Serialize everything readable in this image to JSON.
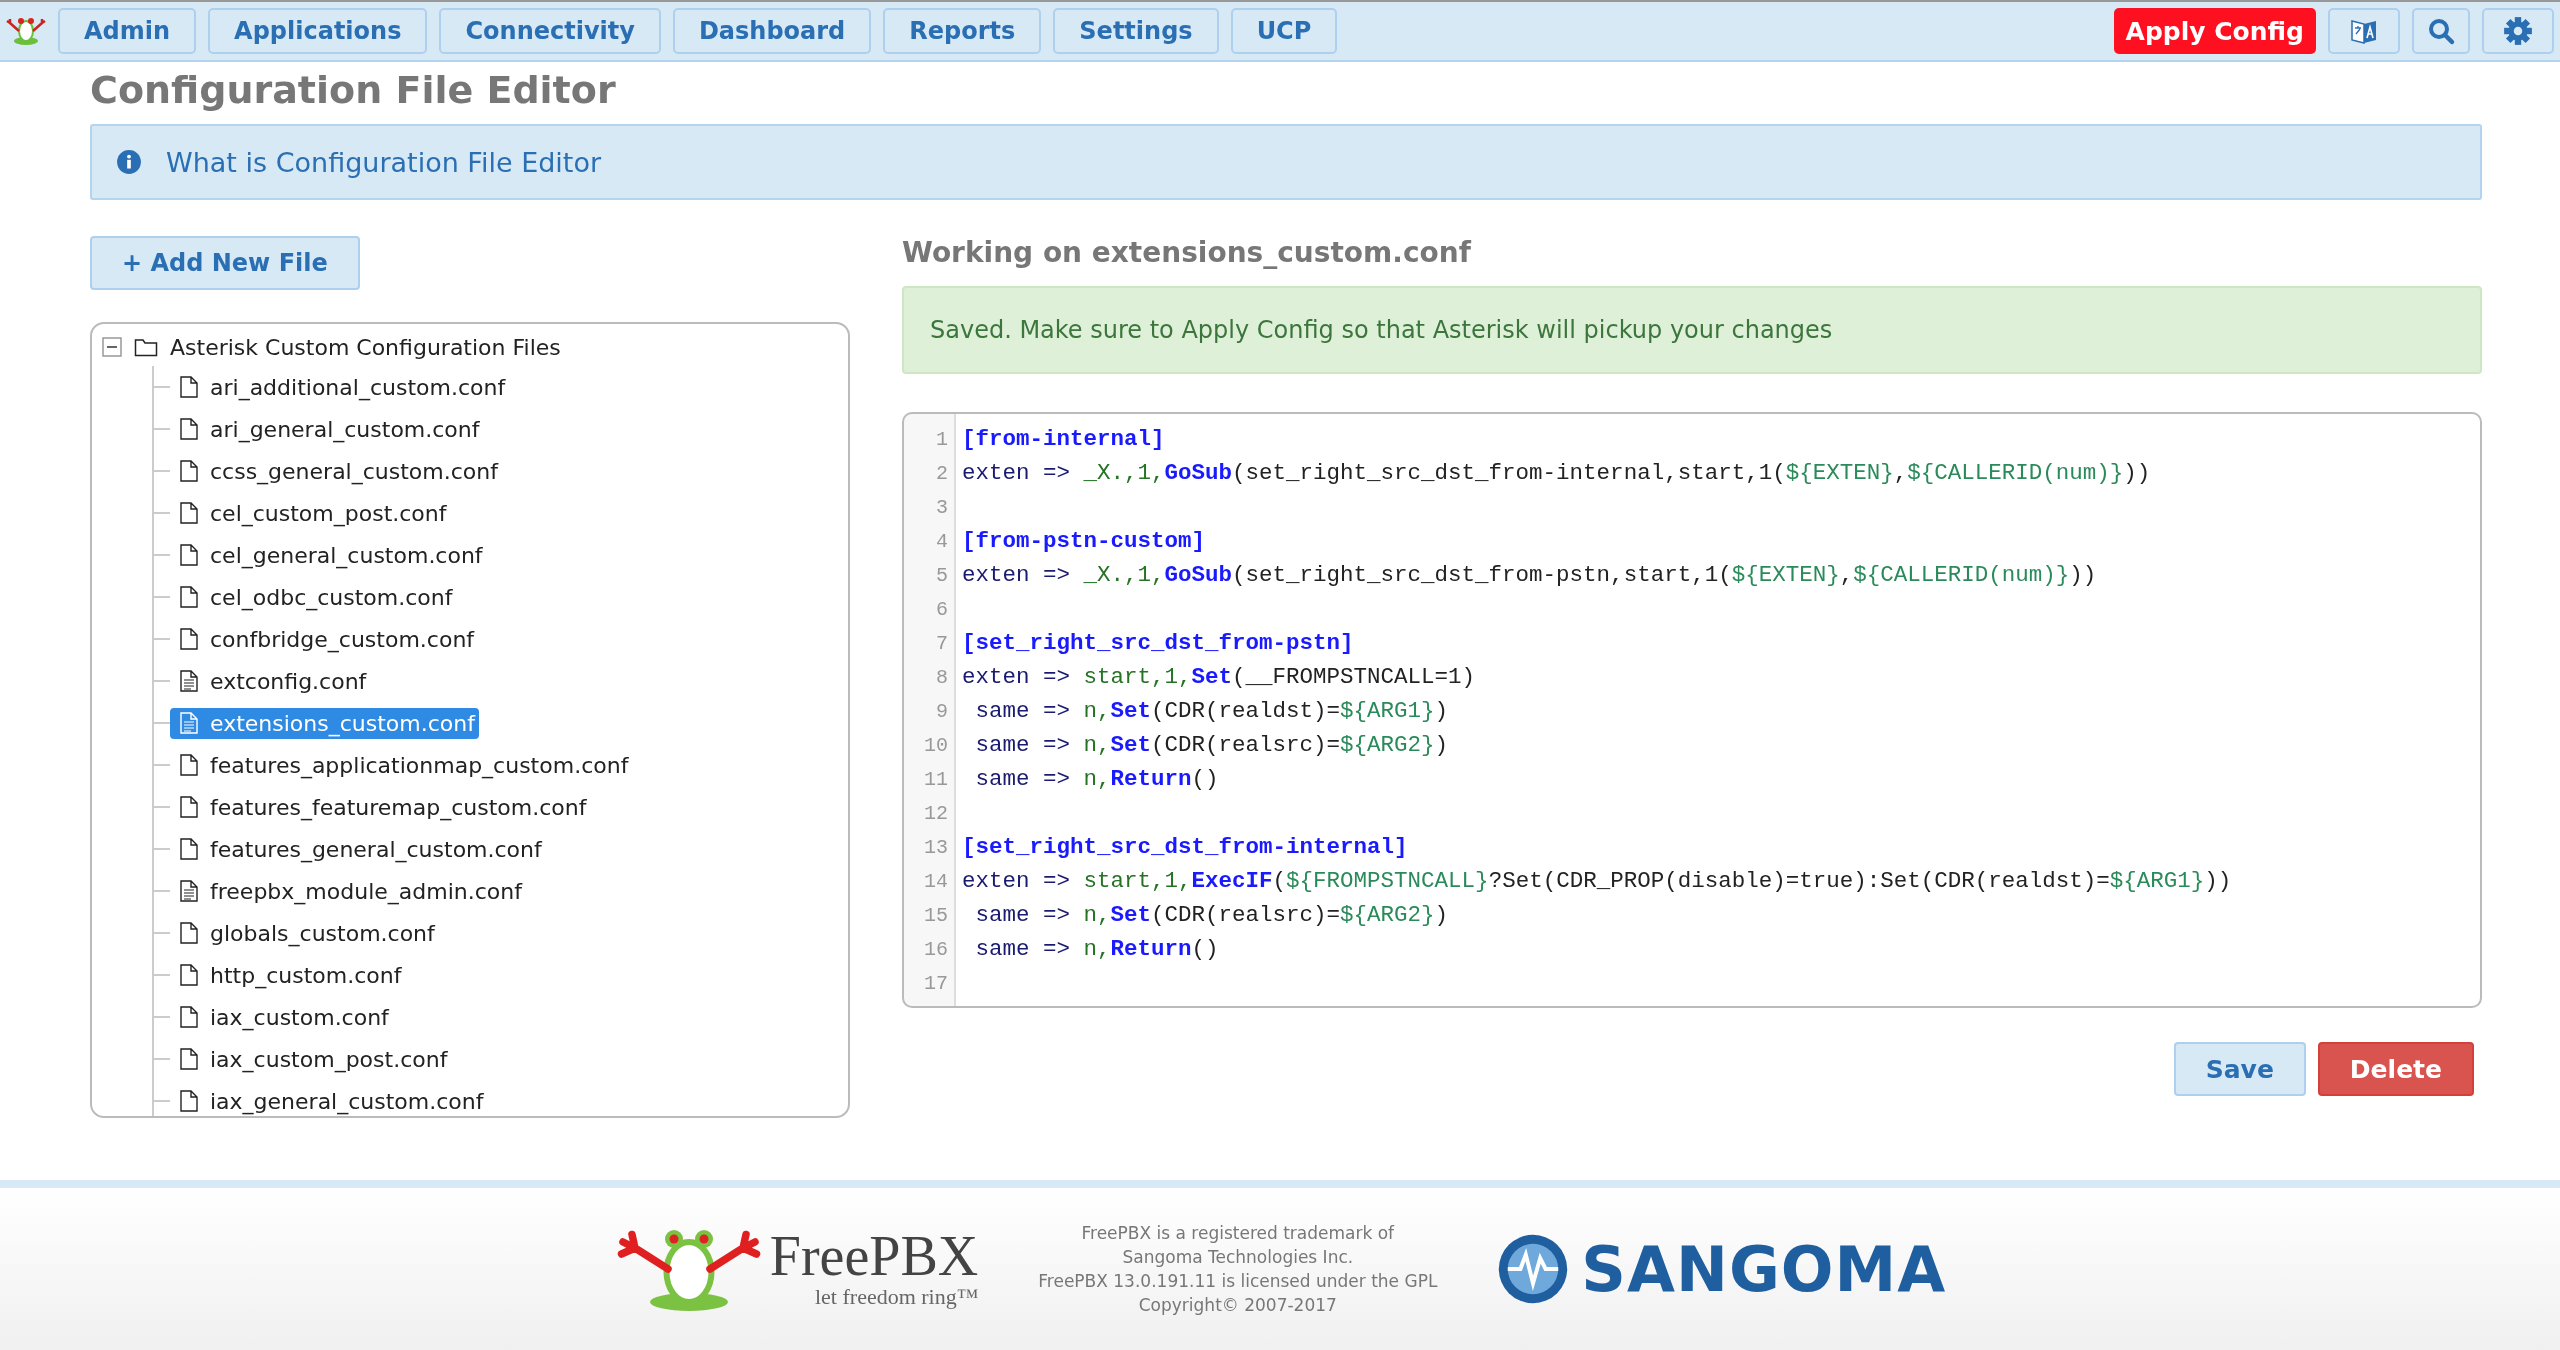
{
  "nav": {
    "items": [
      {
        "label": "Admin"
      },
      {
        "label": "Applications"
      },
      {
        "label": "Connectivity"
      },
      {
        "label": "Dashboard"
      },
      {
        "label": "Reports"
      },
      {
        "label": "Settings"
      },
      {
        "label": "UCP"
      }
    ],
    "apply_button": "Apply Config"
  },
  "page_title": "Configuration File Editor",
  "info_bar": "What is Configuration File Editor",
  "add_button": "+ Add New File",
  "tree": {
    "label": "Asterisk Custom Configuration Files",
    "expanded": true,
    "children": [
      {
        "label": "ari_additional_custom.conf",
        "kind": "empty",
        "selected": false
      },
      {
        "label": "ari_general_custom.conf",
        "kind": "empty",
        "selected": false
      },
      {
        "label": "ccss_general_custom.conf",
        "kind": "empty",
        "selected": false
      },
      {
        "label": "cel_custom_post.conf",
        "kind": "empty",
        "selected": false
      },
      {
        "label": "cel_general_custom.conf",
        "kind": "empty",
        "selected": false
      },
      {
        "label": "cel_odbc_custom.conf",
        "kind": "empty",
        "selected": false
      },
      {
        "label": "confbridge_custom.conf",
        "kind": "empty",
        "selected": false
      },
      {
        "label": "extconfig.conf",
        "kind": "text",
        "selected": false
      },
      {
        "label": "extensions_custom.conf",
        "kind": "text",
        "selected": true
      },
      {
        "label": "features_applicationmap_custom.conf",
        "kind": "empty",
        "selected": false
      },
      {
        "label": "features_featuremap_custom.conf",
        "kind": "empty",
        "selected": false
      },
      {
        "label": "features_general_custom.conf",
        "kind": "empty",
        "selected": false
      },
      {
        "label": "freepbx_module_admin.conf",
        "kind": "text",
        "selected": false
      },
      {
        "label": "globals_custom.conf",
        "kind": "empty",
        "selected": false
      },
      {
        "label": "http_custom.conf",
        "kind": "empty",
        "selected": false
      },
      {
        "label": "iax_custom.conf",
        "kind": "empty",
        "selected": false
      },
      {
        "label": "iax_custom_post.conf",
        "kind": "empty",
        "selected": false
      },
      {
        "label": "iax_general_custom.conf",
        "kind": "empty",
        "selected": false
      }
    ]
  },
  "editor_heading": "Working on extensions_custom.conf",
  "alert": "Saved. Make sure to Apply Config so that Asterisk will pickup your changes",
  "code": [
    {
      "number": "1",
      "tokens": [
        {
          "kind": "section",
          "text": "[from-internal]"
        }
      ]
    },
    {
      "number": "2",
      "tokens": [
        {
          "kind": "keyword",
          "text": "exten => "
        },
        {
          "kind": "value",
          "text": "_X.,1,"
        },
        {
          "kind": "function",
          "text": "GoSub"
        },
        {
          "kind": "plain",
          "text": "(set_right_src_dst_from-internal,start,1("
        },
        {
          "kind": "variable",
          "text": "${EXTEN}"
        },
        {
          "kind": "plain",
          "text": ","
        },
        {
          "kind": "variable",
          "text": "${CALLERID(num)}"
        },
        {
          "kind": "plain",
          "text": "))"
        }
      ]
    },
    {
      "number": "3"
    },
    {
      "number": "4",
      "tokens": [
        {
          "kind": "section",
          "text": "[from-pstn-custom]"
        }
      ]
    },
    {
      "number": "5",
      "tokens": [
        {
          "kind": "keyword",
          "text": "exten => "
        },
        {
          "kind": "value",
          "text": "_X.,1,"
        },
        {
          "kind": "function",
          "text": "GoSub"
        },
        {
          "kind": "plain",
          "text": "(set_right_src_dst_from-pstn,start,1("
        },
        {
          "kind": "variable",
          "text": "${EXTEN}"
        },
        {
          "kind": "plain",
          "text": ","
        },
        {
          "kind": "variable",
          "text": "${CALLERID(num)}"
        },
        {
          "kind": "plain",
          "text": "))"
        }
      ]
    },
    {
      "number": "6"
    },
    {
      "number": "7",
      "tokens": [
        {
          "kind": "section",
          "text": "[set_right_src_dst_from-pstn]"
        }
      ]
    },
    {
      "number": "8",
      "tokens": [
        {
          "kind": "keyword",
          "text": "exten => "
        },
        {
          "kind": "value",
          "text": "start,1,"
        },
        {
          "kind": "function",
          "text": "Set"
        },
        {
          "kind": "plain",
          "text": "(__FROMPSTNCALL=1)"
        }
      ]
    },
    {
      "number": "9",
      "tokens": [
        {
          "kind": "keyword",
          "text": " same => "
        },
        {
          "kind": "value",
          "text": "n,"
        },
        {
          "kind": "function",
          "text": "Set"
        },
        {
          "kind": "plain",
          "text": "(CDR(realdst)="
        },
        {
          "kind": "variable",
          "text": "${ARG1}"
        },
        {
          "kind": "plain",
          "text": ")"
        }
      ]
    },
    {
      "number": "10",
      "tokens": [
        {
          "kind": "keyword",
          "text": " same => "
        },
        {
          "kind": "value",
          "text": "n,"
        },
        {
          "kind": "function",
          "text": "Set"
        },
        {
          "kind": "plain",
          "text": "(CDR(realsrc)="
        },
        {
          "kind": "variable",
          "text": "${ARG2}"
        },
        {
          "kind": "plain",
          "text": ")"
        }
      ]
    },
    {
      "number": "11",
      "tokens": [
        {
          "kind": "keyword",
          "text": " same => "
        },
        {
          "kind": "value",
          "text": "n,"
        },
        {
          "kind": "function",
          "text": "Return"
        },
        {
          "kind": "plain",
          "text": "()"
        }
      ]
    },
    {
      "number": "12"
    },
    {
      "number": "13",
      "tokens": [
        {
          "kind": "section",
          "text": "[set_right_src_dst_from-internal]"
        }
      ]
    },
    {
      "number": "14",
      "tokens": [
        {
          "kind": "keyword",
          "text": "exten => "
        },
        {
          "kind": "value",
          "text": "start,1,"
        },
        {
          "kind": "function",
          "text": "ExecIF"
        },
        {
          "kind": "plain",
          "text": "("
        },
        {
          "kind": "variable",
          "text": "${FROMPSTNCALL}"
        },
        {
          "kind": "plain",
          "text": "?Set(CDR_PROP(disable)=true):Set(CDR(realdst)="
        },
        {
          "kind": "variable",
          "text": "${ARG1}"
        },
        {
          "kind": "plain",
          "text": "))"
        }
      ]
    },
    {
      "number": "15",
      "tokens": [
        {
          "kind": "keyword",
          "text": " same => "
        },
        {
          "kind": "value",
          "text": "n,"
        },
        {
          "kind": "function",
          "text": "Set"
        },
        {
          "kind": "plain",
          "text": "(CDR(realsrc)="
        },
        {
          "kind": "variable",
          "text": "${ARG2}"
        },
        {
          "kind": "plain",
          "text": ")"
        }
      ]
    },
    {
      "number": "16",
      "tokens": [
        {
          "kind": "keyword",
          "text": " same => "
        },
        {
          "kind": "value",
          "text": "n,"
        },
        {
          "kind": "function",
          "text": "Return"
        },
        {
          "kind": "plain",
          "text": "()"
        }
      ]
    },
    {
      "number": "17"
    }
  ],
  "buttons": [
    {
      "label": "Save",
      "kind": "save"
    },
    {
      "label": "Delete",
      "kind": "delete"
    }
  ],
  "footer": {
    "brand": "FreePBX",
    "tagline": "let freedom ring™",
    "legal": [
      "FreePBX is a registered trademark of",
      "Sangoma Technologies Inc.",
      "FreePBX 13.0.191.11 is licensed under the GPL",
      "Copyright© 2007-2017"
    ],
    "partner": "SANGOMA"
  }
}
